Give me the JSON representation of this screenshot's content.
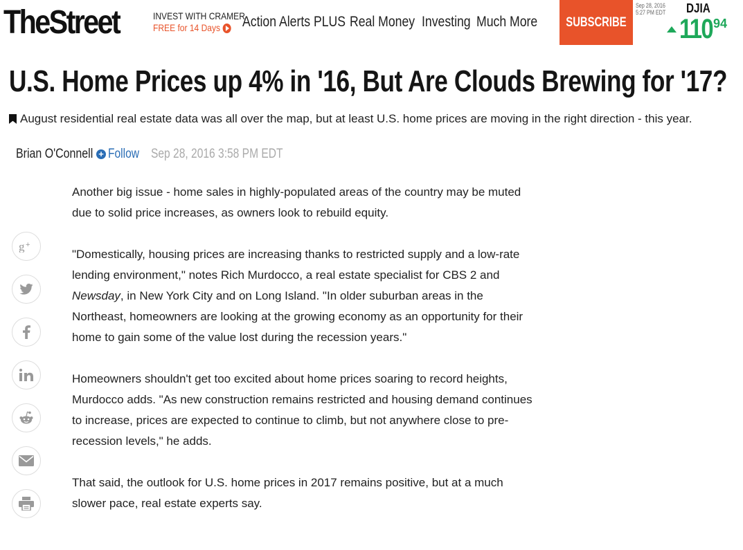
{
  "header": {
    "logo": "TheStreet",
    "promo_line1": "INVEST WITH CRAMER",
    "promo_line2": "FREE for 14 Days",
    "nav": [
      "Action Alerts PLUS",
      "Real Money",
      "Investing",
      "Much More"
    ],
    "subscribe_label": "SUBSCRIBE",
    "ticker": {
      "date_line1": "Sep 28, 2016",
      "date_line2": "5:27 PM EDT",
      "symbol": "DJIA",
      "change_int": "110",
      "change_dec": ".94",
      "direction": "up",
      "color": "#1ea85a"
    }
  },
  "article": {
    "headline": "U.S. Home Prices up 4% in '16, But Are Clouds Brewing for '17?",
    "deck": "August residential real estate data was all over the map, but at least U.S. home prices are moving in the right direction - this year.",
    "author": "Brian O'Connell",
    "follow_label": "Follow",
    "timestamp": "Sep 28, 2016 3:58 PM EDT",
    "p1": "Another big issue - home sales in highly-populated areas of the country may be muted due to solid price increases, as owners look to rebuild equity.",
    "p2_a": "\"Domestically, housing prices are increasing thanks to restricted supply and a low-rate lending environment,\" notes Rich Murdocco, a real estate specialist for CBS 2 and ",
    "p2_em": "Newsday",
    "p2_b": ", in New York City and on Long Island. \"In older suburban areas in the Northeast, homeowners are looking at the growing economy as an opportunity for their home to gain some of the value lost during the recession years.\"",
    "p3": "Homeowners shouldn't get too excited about home prices soaring to record heights, Murdocco adds. \"As new construction remains restricted and housing demand continues to increase, prices are expected to continue to climb, but not anywhere close to pre-recession levels,\" he adds.",
    "p4": "That said, the outlook for U.S. home prices in 2017 remains positive, but at a much slower pace, real estate experts say."
  },
  "share_icons": [
    "google-plus-icon",
    "twitter-icon",
    "facebook-icon",
    "linkedin-icon",
    "reddit-icon",
    "email-icon",
    "print-icon"
  ],
  "colors": {
    "accent": "#e8532a",
    "link": "#2a6db5",
    "ticker_up": "#1ea85a"
  }
}
